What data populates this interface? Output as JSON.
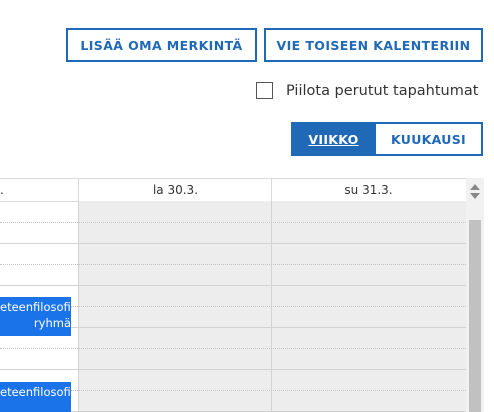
{
  "toolbar": {
    "add_entry_label": "LISÄÄ OMA MERKINTÄ",
    "export_label": "VIE TOISEEN KALENTERIIN"
  },
  "filters": {
    "hide_cancelled_label": "Piilota perutut tapahtumat",
    "hide_cancelled_checked": false
  },
  "view_switch": {
    "week_label": "VIIKKO",
    "month_label": "KUUKAUSI",
    "active": "week"
  },
  "calendar": {
    "headers": [
      ".",
      "la 30.3.",
      "su 31.3."
    ],
    "events": [
      {
        "lines": [
          "eteenfilosofia",
          "ryhmä"
        ]
      },
      {
        "lines": [
          "eteenfilosofia"
        ]
      }
    ]
  },
  "colors": {
    "accent": "#1f69b6",
    "event": "#1a73e8",
    "weekend_bg": "#ededed"
  }
}
